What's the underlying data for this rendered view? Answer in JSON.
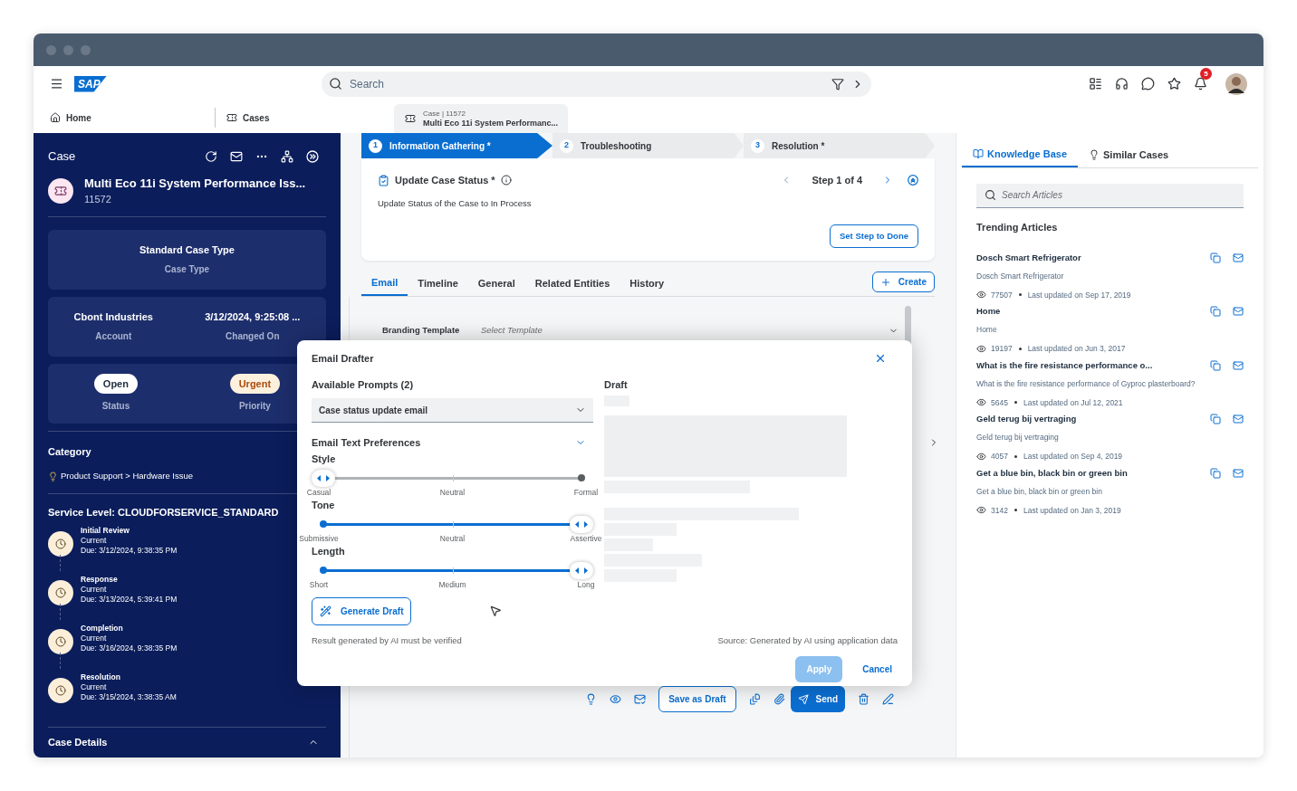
{
  "header": {
    "logo": "SAP",
    "search": {
      "placeholder": "Search"
    },
    "notifications": "5"
  },
  "nav": [
    {
      "kind": "page",
      "label": "Home",
      "selected": false
    },
    {
      "kind": "page",
      "label": "Cases",
      "selected": false
    },
    {
      "kind": "record",
      "caption": "Case | 11572",
      "label": "Multi Eco 11i System Performanc...",
      "selected": true
    }
  ],
  "sidebar": {
    "heading": "Case",
    "title": "Multi Eco 11i System Performance Iss...",
    "id": "11572",
    "cards": [
      [
        {
          "kind": "text",
          "value": "Standard Case Type",
          "label": "Case Type"
        }
      ],
      [
        {
          "kind": "text",
          "value": "Cbont Industries",
          "label": "Account"
        },
        {
          "kind": "text",
          "value": "3/12/2024, 9:25:08 ...",
          "label": "Changed On"
        }
      ],
      [
        {
          "kind": "badge",
          "value": "Open",
          "label": "Status",
          "color": "#ffffff"
        },
        {
          "kind": "badge",
          "value": "Urgent",
          "label": "Priority",
          "color": "#fdf1de"
        }
      ]
    ],
    "category": {
      "title": "Category",
      "path": "Product Support > Hardware Issue"
    },
    "service_level": {
      "title": "Service Level: CLOUDFORSERVICE_STANDARD",
      "milestones": [
        {
          "name": "Initial Review",
          "status": "Current",
          "due": "Due: 3/12/2024, 9:38:35 PM"
        },
        {
          "name": "Response",
          "status": "Current",
          "due": "Due: 3/13/2024, 5:39:41 PM"
        },
        {
          "name": "Completion",
          "status": "Current",
          "due": "Due: 3/16/2024, 9:38:35 PM"
        },
        {
          "name": "Resolution",
          "status": "Current",
          "due": "Due: 3/15/2024, 3:38:35 AM"
        }
      ]
    },
    "case_details": {
      "title": "Case Details",
      "expanded": true
    }
  },
  "stepper": [
    {
      "number": "1",
      "label": "Information Gathering *",
      "selected": true
    },
    {
      "number": "2",
      "label": "Troubleshooting",
      "selected": false
    },
    {
      "number": "3",
      "label": "Resolution *",
      "selected": false
    }
  ],
  "task": {
    "title": "Update Case Status *",
    "description": "Update Status of the Case to In Process",
    "step": "Step 1 of 4",
    "button": "Set Step to Done"
  },
  "tabs": [
    {
      "label": "Email",
      "selected": true
    },
    {
      "label": "Timeline",
      "selected": false
    },
    {
      "label": "General",
      "selected": false
    },
    {
      "label": "Related Entities",
      "selected": false
    },
    {
      "label": "History",
      "selected": false
    }
  ],
  "create_button": "Create",
  "branding": {
    "label": "Branding Template",
    "placeholder": "Select Template"
  },
  "toolbar": {
    "save": "Save as Draft",
    "send": "Send"
  },
  "dialog": {
    "title": "Email Drafter",
    "prompts_label": "Available Prompts (2)",
    "prompt": "Case status update email",
    "prefs_title": "Email Text Preferences",
    "prefs_expanded": true,
    "sliders": [
      {
        "label": "Style",
        "level": 0,
        "ticks": [
          "Casual",
          "Neutral",
          "Formal"
        ]
      },
      {
        "label": "Tone",
        "level": 1,
        "ticks": [
          "Submissive",
          "Neutral",
          "Assertive"
        ]
      },
      {
        "label": "Length",
        "level": 1,
        "ticks": [
          "Short",
          "Medium",
          "Long"
        ]
      }
    ],
    "generate": "Generate Draft",
    "note": "Result generated by AI must be verified",
    "source": "Source: Generated by AI using application data",
    "draft_label": "Draft",
    "apply": {
      "label": "Apply",
      "disabled": true
    },
    "cancel": "Cancel"
  },
  "knowledge": {
    "tabs": [
      {
        "label": "Knowledge Base",
        "selected": true
      },
      {
        "label": "Similar Cases",
        "selected": false
      }
    ],
    "search": {
      "placeholder": "Search Articles"
    },
    "heading": "Trending Articles",
    "articles": [
      {
        "title": "Dosch Smart Refrigerator",
        "summary": "Dosch Smart Refrigerator",
        "views": "77507",
        "updated": "Last updated on Sep 17, 2019"
      },
      {
        "title": "Home",
        "summary": "Home",
        "views": "19197",
        "updated": "Last updated on Jun 3, 2017"
      },
      {
        "title": "What is the fire resistance performance o...",
        "summary": "What is the fire resistance performance of Gyproc plasterboard?",
        "views": "5645",
        "updated": "Last updated on Jul 12, 2021"
      },
      {
        "title": "Geld terug bij vertraging",
        "summary": "Geld terug bij vertraging",
        "views": "4057",
        "updated": "Last updated on Sep 4, 2019"
      },
      {
        "title": "Get a blue bin, black bin or green bin",
        "summary": "Get a blue bin, black bin or green bin",
        "views": "3142",
        "updated": "Last updated on Jan 3, 2019"
      }
    ]
  }
}
